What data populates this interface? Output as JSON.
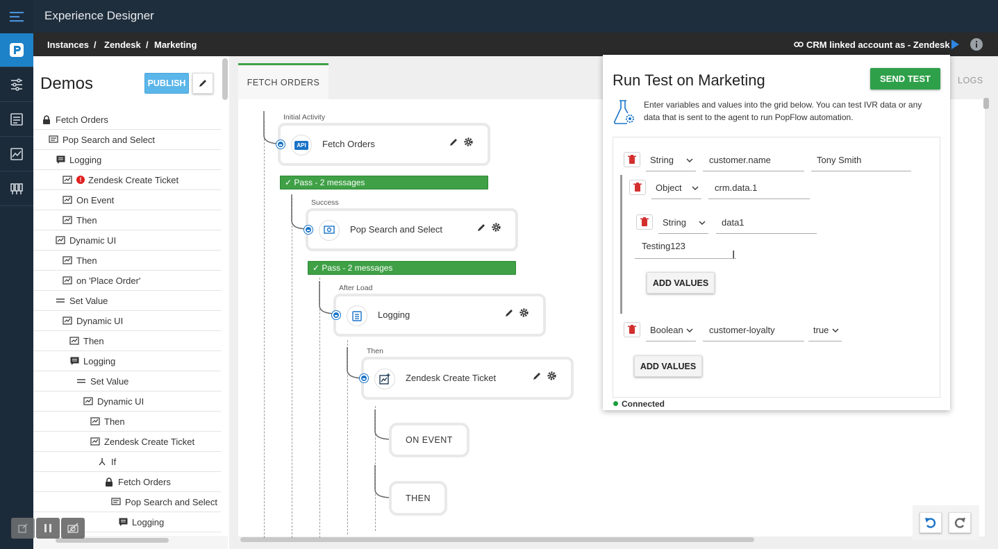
{
  "app": {
    "title": "Experience Designer"
  },
  "breadcrumb": {
    "items": [
      "Instances",
      "/",
      "Zendesk",
      "/",
      "Marketing"
    ]
  },
  "header": {
    "crm_link": "CRM linked account as - Zendesk"
  },
  "sidebar": {
    "title": "Demos",
    "publish_label": "PUBLISH",
    "tree": [
      {
        "label": "Fetch Orders",
        "icon": "lock-icon"
      },
      {
        "label": "Pop Search and Select",
        "icon": "screen-icon"
      },
      {
        "label": "Logging",
        "icon": "message-icon"
      },
      {
        "label": "Zendesk Create Ticket",
        "icon": "activity-icon",
        "error": true
      },
      {
        "label": "On Event",
        "icon": "activity-icon"
      },
      {
        "label": "Then",
        "icon": "activity-icon"
      },
      {
        "label": "Dynamic UI",
        "icon": "activity-icon"
      },
      {
        "label": "Then",
        "icon": "activity-icon"
      },
      {
        "label": "on 'Place Order'",
        "icon": "activity-icon"
      },
      {
        "label": "Set Value",
        "icon": "set-value-icon"
      },
      {
        "label": "Dynamic UI",
        "icon": "activity-icon"
      },
      {
        "label": "Then",
        "icon": "activity-icon"
      },
      {
        "label": "Logging",
        "icon": "message-icon"
      },
      {
        "label": "Set Value",
        "icon": "set-value-icon"
      },
      {
        "label": "Dynamic UI",
        "icon": "activity-icon"
      },
      {
        "label": "Then",
        "icon": "activity-icon"
      },
      {
        "label": "Zendesk Create Ticket",
        "icon": "activity-icon"
      },
      {
        "label": "If",
        "icon": "branch-icon"
      },
      {
        "label": "Fetch Orders",
        "icon": "lock-icon"
      },
      {
        "label": "Pop Search and Select",
        "icon": "screen-icon"
      },
      {
        "label": "Logging",
        "icon": "message-icon"
      }
    ]
  },
  "canvas": {
    "tab": "FETCH ORDERS",
    "logs_tab": "LOGS",
    "initial_activity": "Initial Activity",
    "fetch_orders": "Fetch Orders",
    "api_badge": "API",
    "pass1": "Pass - 2 messages",
    "success": "Success",
    "pop_search": "Pop Search and Select",
    "pass2": "Pass - 2 messages",
    "after_load": "After Load",
    "logging": "Logging",
    "then_label": "Then",
    "zendesk": "Zendesk Create Ticket",
    "on_event": "ON EVENT",
    "then": "THEN"
  },
  "test_panel": {
    "title": "Run Test on Marketing",
    "send_label": "SEND TEST",
    "description": "Enter variables and values into the grid below. You can test IVR data or any data that is sent to the agent to run PopFlow automation.",
    "rows": {
      "r1": {
        "type": "String",
        "key": "customer.name",
        "value": "Tony Smith"
      },
      "r2": {
        "type": "Object",
        "key": "crm.data.1"
      },
      "r2a": {
        "type": "String",
        "key": "data1",
        "value": "Testing123"
      },
      "r3": {
        "type": "Boolean",
        "key": "customer-loyalty",
        "value": "true"
      }
    },
    "add_values": "ADD VALUES",
    "status": "Connected"
  },
  "colors": {
    "accent": "#1a73c8",
    "pass": "#3fa046",
    "send": "#2fa04a",
    "publish": "#5bb6ea",
    "trash": "#d32f2f"
  }
}
